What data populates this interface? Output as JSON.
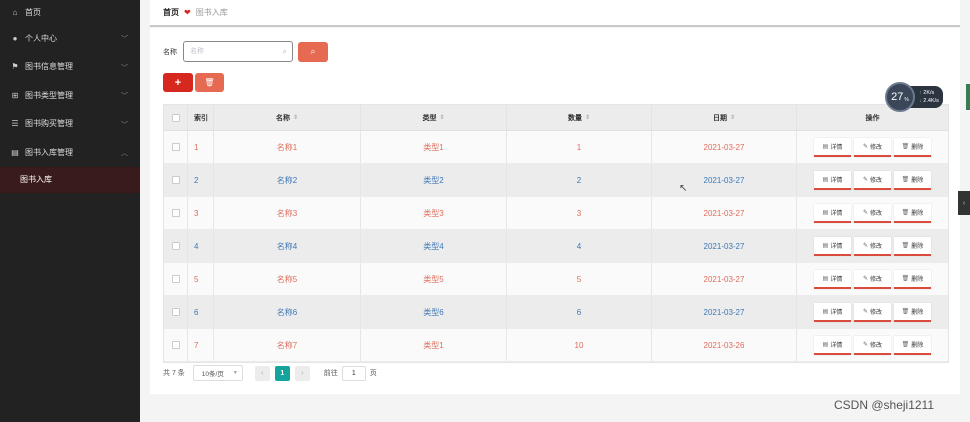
{
  "sidebar": {
    "items": [
      {
        "label": "首页",
        "icon": "home-icon",
        "chevron": ""
      },
      {
        "label": "个人中心",
        "icon": "user-icon",
        "chevron": "﹀"
      },
      {
        "label": "图书信息管理",
        "icon": "flag-icon",
        "chevron": "﹀"
      },
      {
        "label": "图书类型管理",
        "icon": "grid-icon",
        "chevron": "﹀"
      },
      {
        "label": "图书购买管理",
        "icon": "sliders-icon",
        "chevron": "﹀"
      },
      {
        "label": "图书入库管理",
        "icon": "book-icon",
        "chevron": "︿"
      }
    ],
    "sub_item": "图书入库"
  },
  "breadcrumb": {
    "home": "首页",
    "current": "图书入库"
  },
  "search": {
    "label": "名称",
    "placeholder": "名称",
    "value": ""
  },
  "toolbar": {
    "add_label": "+",
    "delete_icon": "trash-icon"
  },
  "table": {
    "headers": {
      "index": "索引",
      "name": "名称",
      "type": "类型",
      "quantity": "数量",
      "date": "日期",
      "ops": "操作"
    },
    "ops": {
      "detail": "详情",
      "edit": "修改",
      "delete": "删除"
    },
    "rows": [
      {
        "index": "1",
        "name": "名称1",
        "type": "类型1",
        "quantity": "1",
        "date": "2021-03-27"
      },
      {
        "index": "2",
        "name": "名称2",
        "type": "类型2",
        "quantity": "2",
        "date": "2021-03-27"
      },
      {
        "index": "3",
        "name": "名称3",
        "type": "类型3",
        "quantity": "3",
        "date": "2021-03-27"
      },
      {
        "index": "4",
        "name": "名称4",
        "type": "类型4",
        "quantity": "4",
        "date": "2021-03-27"
      },
      {
        "index": "5",
        "name": "名称5",
        "type": "类型5",
        "quantity": "5",
        "date": "2021-03-27"
      },
      {
        "index": "6",
        "name": "名称6",
        "type": "类型6",
        "quantity": "6",
        "date": "2021-03-27"
      },
      {
        "index": "7",
        "name": "名称7",
        "type": "类型1",
        "quantity": "10",
        "date": "2021-03-26"
      }
    ]
  },
  "pager": {
    "total": "共 7 条",
    "page_size": "10条/页",
    "current_page": "1",
    "goto_prefix": "前往",
    "goto_value": "1",
    "goto_suffix": "页",
    "prev": "‹",
    "next": "›"
  },
  "widget": {
    "speed": "27",
    "unit": "%",
    "up": "2",
    "up_unit": "K/s",
    "down": "2.4",
    "down_unit": "K/s"
  },
  "watermark": "CSDN @sheji1211",
  "colors": {
    "accent": "#d7281f",
    "odd_text": "#e06c5a",
    "even_text": "#3d78b8",
    "active_page": "#14a39d"
  }
}
